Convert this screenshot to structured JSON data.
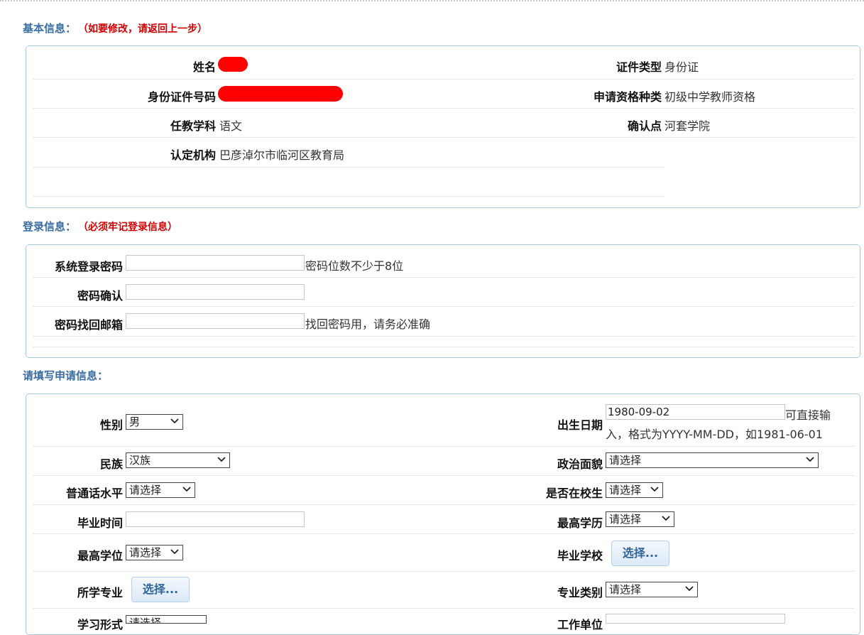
{
  "basic": {
    "title": "基本信息：",
    "note": "（如要修改，请返回上一步）",
    "name_label": "姓名",
    "id_type_label": "证件类型",
    "id_type_value": "身份证",
    "id_number_label": "身份证件号码",
    "qual_type_label": "申请资格种类",
    "qual_type_value": "初级中学教师资格",
    "subject_label": "任教学科",
    "subject_value": "语文",
    "confirm_point_label": "确认点",
    "confirm_point_value": "河套学院",
    "agency_label": "认定机构",
    "agency_value": "巴彦淖尔市临河区教育局"
  },
  "login": {
    "title": "登录信息：",
    "note": "（必须牢记登录信息）",
    "password_label": "系统登录密码",
    "password_hint": "密码位数不少于8位",
    "confirm_label": "密码确认",
    "email_label": "密码找回邮箱",
    "email_hint": "找回密码用，请务必准确"
  },
  "apply": {
    "title": "请填写申请信息：",
    "gender_label": "性别",
    "gender_value": "男",
    "birth_label": "出生日期",
    "birth_value": "1980-09-02",
    "birth_hint_1": "可直接输",
    "birth_hint_2": "入，格式为YYYY-MM-DD，如1981-06-01",
    "ethnic_label": "民族",
    "ethnic_value": "汉族",
    "political_label": "政治面貌",
    "political_value": "请选择",
    "mandarin_label": "普通话水平",
    "mandarin_value": "请选择",
    "student_label": "是否在校生",
    "student_value": "请选择",
    "grad_time_label": "毕业时间",
    "edu_label": "最高学历",
    "edu_value": "请选择",
    "degree_label": "最高学位",
    "degree_value": "请选择",
    "school_label": "毕业学校",
    "school_button": "选择...",
    "major_label": "所学专业",
    "major_button": "选择...",
    "major_cat_label": "专业类别",
    "major_cat_value": "请选择",
    "study_form_label": "学习形式",
    "study_form_value": "请选择",
    "work_unit_label": "工作单位"
  },
  "colors": {
    "section_title": "#3b6e9e",
    "note": "#cc0000",
    "panel_border": "#a9c9df",
    "redact": "#ff0000"
  }
}
